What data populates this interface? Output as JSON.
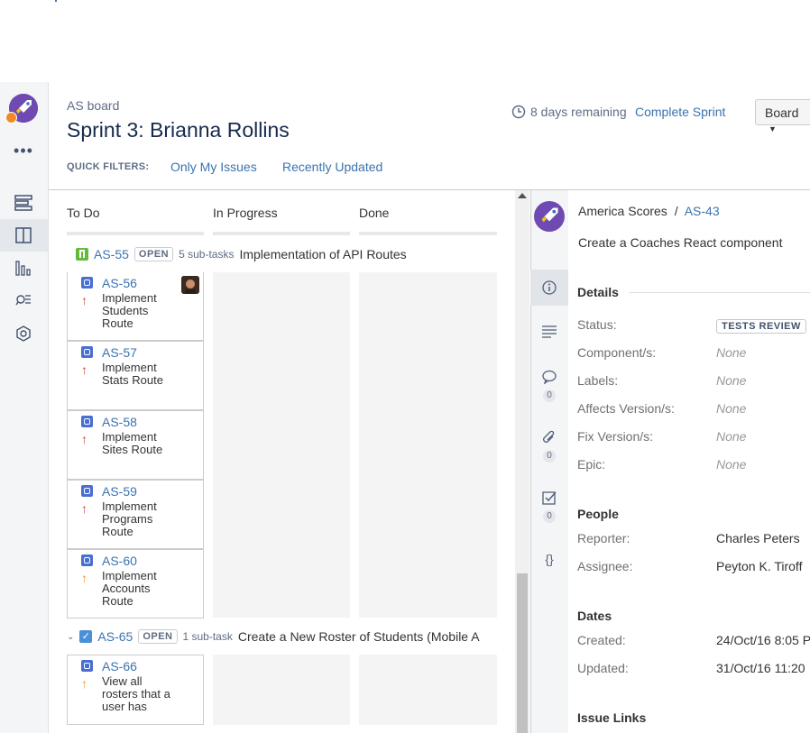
{
  "header": {
    "board_name": "AS board",
    "sprint_title": "Sprint 3: Brianna Rollins",
    "quick_filters_label": "QUICK FILTERS:",
    "quick_filters": [
      "Only My Issues",
      "Recently Updated"
    ],
    "remaining": "8 days remaining",
    "complete_sprint": "Complete Sprint",
    "board_button": "Board"
  },
  "columns": [
    "To Do",
    "In Progress",
    "Done"
  ],
  "swimlanes": [
    {
      "key": "AS-55",
      "status": "OPEN",
      "subtasks": "5 sub-tasks",
      "summary": "Implementation of API Routes",
      "cards": [
        {
          "key": "AS-56",
          "summary": "Implement Students Route",
          "priority": "high"
        },
        {
          "key": "AS-57",
          "summary": "Implement Stats Route",
          "priority": "high"
        },
        {
          "key": "AS-58",
          "summary": "Implement Sites Route",
          "priority": "high"
        },
        {
          "key": "AS-59",
          "summary": "Implement Programs Route",
          "priority": "high"
        },
        {
          "key": "AS-60",
          "summary": "Implement Accounts Route",
          "priority": "medium"
        }
      ]
    },
    {
      "key": "AS-65",
      "status": "OPEN",
      "subtasks": "1 sub-task",
      "summary": "Create a New Roster of Students (Mobile A",
      "cards": [
        {
          "key": "AS-66",
          "summary": "View all rosters that a user has",
          "priority": "medium"
        }
      ]
    }
  ],
  "detail": {
    "project": "America Scores",
    "separator": "/",
    "issue_key": "AS-43",
    "summary": "Create a Coaches React component",
    "details_title": "Details",
    "fields": [
      {
        "label": "Status:",
        "value": "TESTS REVIEW"
      },
      {
        "label": "Component/s:",
        "value": "None"
      },
      {
        "label": "Labels:",
        "value": "None"
      },
      {
        "label": "Affects Version/s:",
        "value": "None"
      },
      {
        "label": "Fix Version/s:",
        "value": "None"
      },
      {
        "label": "Epic:",
        "value": "None"
      }
    ],
    "people_title": "People",
    "people": [
      {
        "label": "Reporter:",
        "value": "Charles Peters"
      },
      {
        "label": "Assignee:",
        "value": "Peyton K. Tiroff"
      }
    ],
    "dates_title": "Dates",
    "dates": [
      {
        "label": "Created:",
        "value": "24/Oct/16 8:05 P"
      },
      {
        "label": "Updated:",
        "value": "31/Oct/16 11:20"
      }
    ],
    "links_title": "Issue Links",
    "counts": {
      "comments": "0",
      "attachments": "0",
      "subtasks": "0"
    }
  },
  "colors": {
    "link": "#3b73af",
    "priority_high": "#d04437",
    "priority_medium": "#e8902a"
  }
}
